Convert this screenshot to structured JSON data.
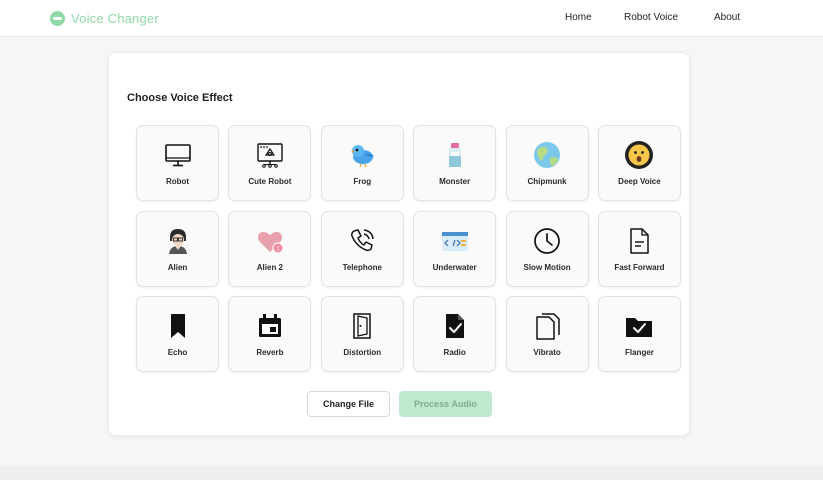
{
  "app": {
    "brand": "Voice Changer",
    "accent_color": "#8fd9a6"
  },
  "nav": {
    "links": [
      {
        "label": "Home"
      },
      {
        "label": "Robot Voice"
      },
      {
        "label": "About"
      }
    ]
  },
  "main": {
    "title": "Choose Voice Effect",
    "effects": [
      {
        "label": "Robot",
        "icon": "monitor-icon"
      },
      {
        "label": "Cute Robot",
        "icon": "robot-monitor-icon"
      },
      {
        "label": "Frog",
        "icon": "bird-icon"
      },
      {
        "label": "Monster",
        "icon": "bottle-icon"
      },
      {
        "label": "Chipmunk",
        "icon": "globe-icon"
      },
      {
        "label": "Deep Voice",
        "icon": "surprised-face-icon"
      },
      {
        "label": "Alien",
        "icon": "person-avatar-icon"
      },
      {
        "label": "Alien 2",
        "icon": "heart-badge-icon"
      },
      {
        "label": "Telephone",
        "icon": "phone-ringing-icon"
      },
      {
        "label": "Underwater",
        "icon": "code-window-icon"
      },
      {
        "label": "Slow Motion",
        "icon": "clock-icon"
      },
      {
        "label": "Fast Forward",
        "icon": "document-icon"
      },
      {
        "label": "Echo",
        "icon": "bookmark-icon"
      },
      {
        "label": "Reverb",
        "icon": "calendar-icon"
      },
      {
        "label": "Distortion",
        "icon": "door-icon"
      },
      {
        "label": "Radio",
        "icon": "file-check-icon"
      },
      {
        "label": "Vibrato",
        "icon": "copy-icon"
      },
      {
        "label": "Flanger",
        "icon": "folder-check-icon"
      }
    ],
    "buttons": {
      "change_file": "Change File",
      "process_audio": "Process Audio"
    }
  }
}
